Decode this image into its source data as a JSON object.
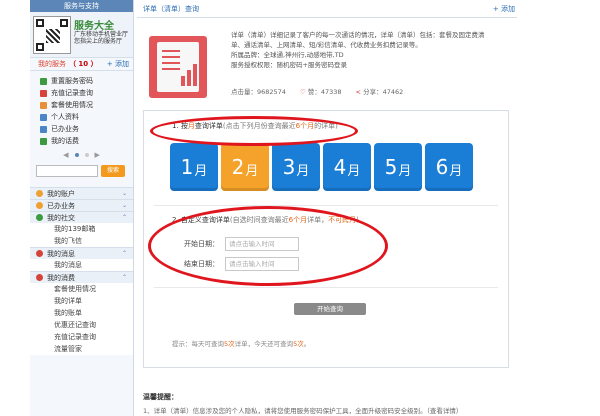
{
  "sidebar": {
    "top_title": "服务与支持",
    "qr": {
      "title": "服务大全",
      "subtitle": "广东移动手机营业厅 您指尖上的服务厅"
    },
    "my_services": {
      "title": "我的服务",
      "count": "（ 10 ）",
      "add": "+ 添加"
    },
    "services": [
      {
        "label": "重置服务密码",
        "color": "#3c9a40"
      },
      {
        "label": "充值记录查询",
        "color": "#d6433a"
      },
      {
        "label": "套餐使用情况",
        "color": "#e6913a"
      },
      {
        "label": "个人资料",
        "color": "#4a86c7"
      },
      {
        "label": "已办业务",
        "color": "#4a86c7"
      },
      {
        "label": "我的话费",
        "color": "#3c9a40"
      }
    ],
    "pager": {
      "prev": "◀",
      "next": "▶"
    },
    "search": {
      "placeholder": "",
      "button": "搜索"
    },
    "categories": [
      {
        "label": "我的账户",
        "color": "#f0a030",
        "chev": "⌄"
      },
      {
        "label": "已办业务",
        "color": "#f0a030",
        "chev": "⌄"
      },
      {
        "label": "我的社交",
        "color": "#3c9a40",
        "chev": "⌃"
      }
    ],
    "social": [
      "我的139邮箱",
      "我的飞信"
    ],
    "msg_cat": {
      "label": "我的消息",
      "color": "#d6433a",
      "chev": "⌃"
    },
    "msg_items": [
      "我的消息"
    ],
    "consume_cat": {
      "label": "我的消费",
      "color": "#d6433a",
      "chev": "⌃"
    },
    "consume_items": [
      "套餐使用情况",
      "我的详单",
      "我的账单",
      "优惠还记查询",
      "充值记录查询",
      "流量管家"
    ]
  },
  "main": {
    "header_title": "详单（清单）查询",
    "header_add": "+ 添加",
    "intro": {
      "line1": "详单（清单）详细记录了客户的每一次通话的情况，详单（清单）包括：套餐及固定费清",
      "line2": "单、通话清单、上网清单、短/彩信清单、代收费业务扣费记录等。",
      "line3": "所属品牌：全球通,神州行,动感地带,TD",
      "line4": "服务授权权限：随机密码+服务密码登录",
      "clicks": "点击量：9682574",
      "likes": "赞：47338",
      "shares": "分享：47462"
    },
    "step1": {
      "prefix": "1. 按",
      "highlight": "月",
      "rest": "查询详单",
      "hint_a": "(点击下列月份查询最近",
      "hint_b": "6个月",
      "hint_c": "的详单)"
    },
    "months": [
      {
        "num": "1",
        "unit": "月",
        "selected": false
      },
      {
        "num": "2",
        "unit": "月",
        "selected": true
      },
      {
        "num": "3",
        "unit": "月",
        "selected": false
      },
      {
        "num": "4",
        "unit": "月",
        "selected": false
      },
      {
        "num": "5",
        "unit": "月",
        "selected": false
      },
      {
        "num": "6",
        "unit": "月",
        "selected": false
      }
    ],
    "step2": {
      "title": "2. 自定义查询详单",
      "hint_a": "(自选时间查询最近",
      "hint_b": "6个月",
      "hint_c": "详单，",
      "hint_d": "不可跨月",
      "hint_e": ")"
    },
    "start_label": "开始日期：",
    "start_placeholder": "请点击输入时间",
    "end_label": "结束日期：",
    "end_placeholder": "请点击输入时间",
    "submit": "开始查询",
    "tip": {
      "a": "提示：每天可查询",
      "b": "5次",
      "c": "详单，今天还可查询",
      "d": "5次",
      "e": "。"
    },
    "notice_title": "温馨提醒：",
    "notice_body": "1、详单（清单）信息涉及您的个人隐私，请将您使用服务密码保护工具，全面升级密码安全级别。（查看详情）"
  }
}
